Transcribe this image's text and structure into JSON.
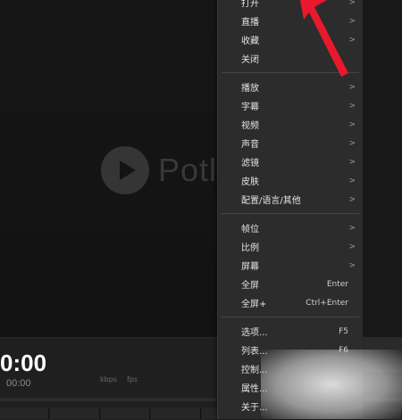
{
  "player": {
    "logo_text": "Potl",
    "time_main": "0:00",
    "time_sub": "00:00",
    "mini_labels": [
      "kbps",
      "fps"
    ]
  },
  "menu": {
    "groups": [
      [
        {
          "label": "打开",
          "has_arrow": true
        },
        {
          "label": "直播",
          "has_arrow": true
        },
        {
          "label": "收藏",
          "has_arrow": true
        },
        {
          "label": "关闭",
          "has_arrow": false
        }
      ],
      [
        {
          "label": "播放",
          "has_arrow": true
        },
        {
          "label": "字幕",
          "has_arrow": true
        },
        {
          "label": "视频",
          "has_arrow": true
        },
        {
          "label": "声音",
          "has_arrow": true
        },
        {
          "label": "滤镜",
          "has_arrow": true
        },
        {
          "label": "皮肤",
          "has_arrow": true
        },
        {
          "label": "配置/语言/其他",
          "has_arrow": true
        }
      ],
      [
        {
          "label": "帧位",
          "has_arrow": true
        },
        {
          "label": "比例",
          "has_arrow": true
        },
        {
          "label": "屏幕",
          "has_arrow": true
        },
        {
          "label": "全屏",
          "shortcut": "Enter"
        },
        {
          "label": "全屏+",
          "shortcut": "Ctrl+Enter"
        }
      ],
      [
        {
          "label": "选项...",
          "shortcut": "F5"
        },
        {
          "label": "列表...",
          "shortcut": "F6"
        },
        {
          "label": "控制..."
        },
        {
          "label": "属性..."
        },
        {
          "label": "关于..."
        }
      ]
    ],
    "arrow_glyph": ">"
  },
  "colors": {
    "accent_arrow": "#e8192c",
    "menu_bg": "#2c2c2c"
  }
}
